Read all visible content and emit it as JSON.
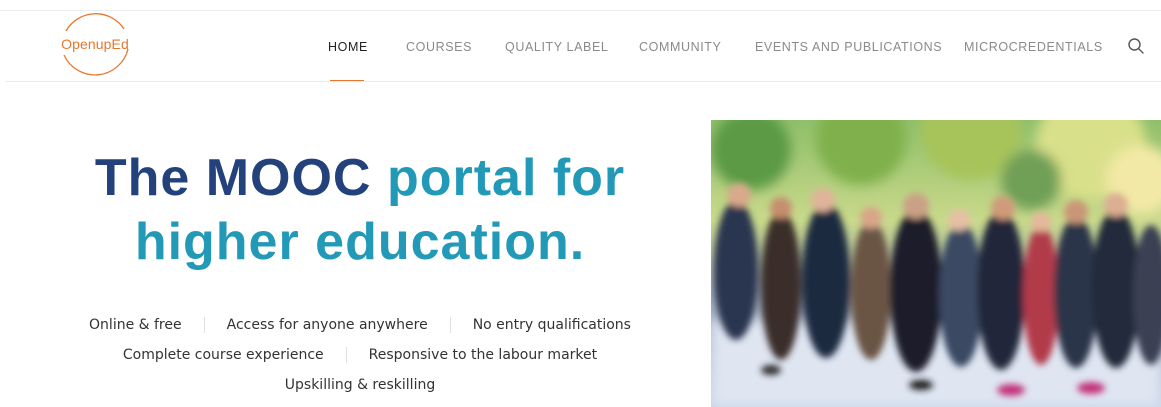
{
  "brand": {
    "logo_text": "OpenupEd",
    "accent_color": "#e8762d"
  },
  "nav": {
    "items": [
      {
        "label": "HOME",
        "active": true
      },
      {
        "label": "COURSES",
        "active": false
      },
      {
        "label": "QUALITY LABEL",
        "active": false
      },
      {
        "label": "COMMUNITY",
        "active": false
      },
      {
        "label": "EVENTS AND PUBLICATIONS",
        "active": false
      },
      {
        "label": "MICROCREDENTIALS",
        "active": false
      }
    ],
    "search_icon": "search-icon"
  },
  "hero": {
    "title_line1_a": "The MOOC",
    "title_line1_b": "portal for",
    "title_line2": "higher education.",
    "title_dark_color": "#23417a",
    "title_teal_color": "#2399b8",
    "features": [
      [
        "Online & free",
        "Access for anyone anywhere",
        "No entry qualifications"
      ],
      [
        "Complete course experience",
        "Responsive to the labour market"
      ],
      [
        "Upskilling & reskilling"
      ]
    ]
  }
}
